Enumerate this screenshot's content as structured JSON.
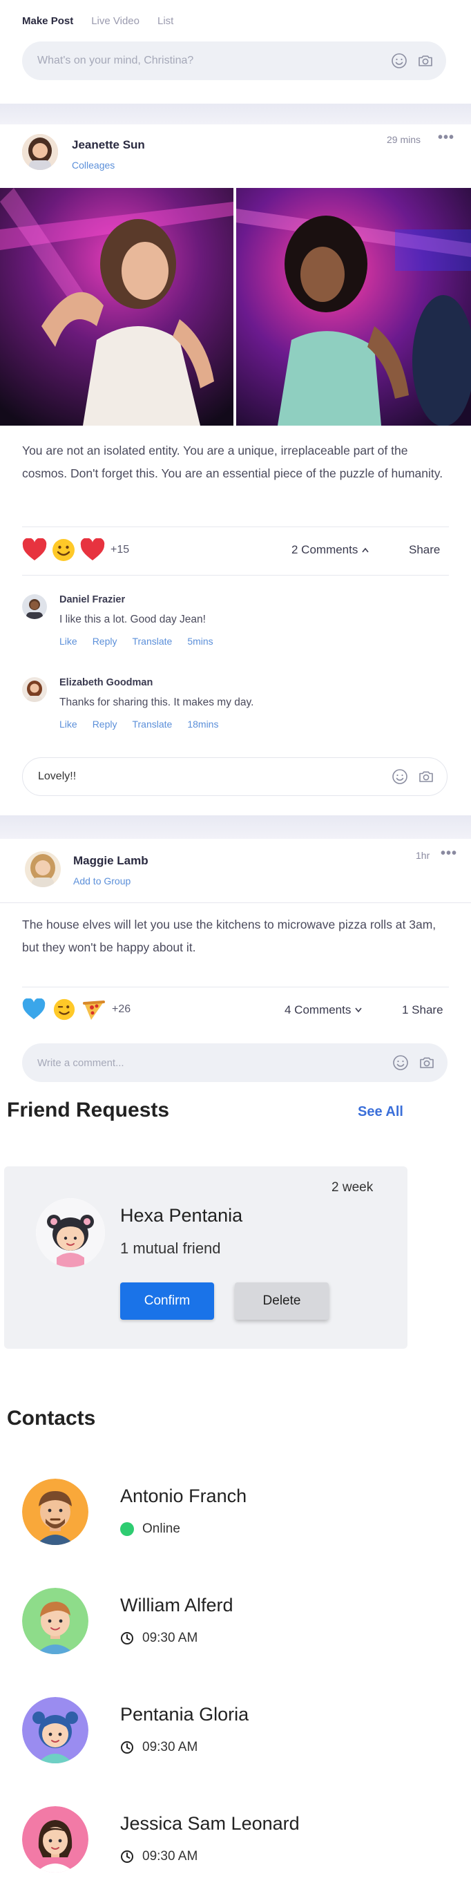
{
  "composer": {
    "tabs": [
      "Make Post",
      "Live Video",
      "List"
    ],
    "placeholder": "What's on your mind, Christina?"
  },
  "post1": {
    "author": "Jeanette Sun",
    "subtitle": "Colleages",
    "time": "29 mins",
    "more": "•••",
    "text": "You are not an isolated entity. You are a unique, irreplaceable part of the cosmos. Don't forget this. You are an essential piece of the puzzle of humanity.",
    "reactions_count": "+15",
    "comments_label": "2 Comments",
    "share_label": "Share",
    "comments": [
      {
        "name": "Daniel Frazier",
        "text": "I like this a lot. Good day Jean!",
        "actions": [
          "Like",
          "Reply",
          "Translate"
        ],
        "time": "5mins"
      },
      {
        "name": "Elizabeth Goodman",
        "text": "Thanks for sharing this. It makes my day.",
        "actions": [
          "Like",
          "Reply",
          "Translate"
        ],
        "time": "18mins"
      }
    ],
    "reply_value": "Lovely!!"
  },
  "post2": {
    "author": "Maggie Lamb",
    "subtitle": "Add to Group",
    "time": "1hr",
    "more": "•••",
    "text": "The house elves will let you use the kitchens to microwave pizza rolls at 3am, but they won't be happy about it.",
    "reactions_count": "+26",
    "comments_label": "4 Comments",
    "share_label": "1 Share",
    "comment_placeholder": "Write a comment..."
  },
  "friend_requests": {
    "title": "Friend Requests",
    "see_all": "See All",
    "request": {
      "name": "Hexa Pentania",
      "mutual": "1 mutual friend",
      "time": "2 week",
      "confirm": "Confirm",
      "delete": "Delete"
    }
  },
  "contacts": {
    "title": "Contacts",
    "items": [
      {
        "name": "Antonio Franch",
        "status": "Online"
      },
      {
        "name": "William Alferd",
        "status": "09:30 AM"
      },
      {
        "name": "Pentania Gloria",
        "status": "09:30 AM"
      },
      {
        "name": "Jessica Sam Leonard",
        "status": "09:30 AM"
      }
    ]
  },
  "colors": {
    "accent": "#5b8fd9",
    "confirm": "#1a73e8",
    "online": "#2ecc71"
  }
}
